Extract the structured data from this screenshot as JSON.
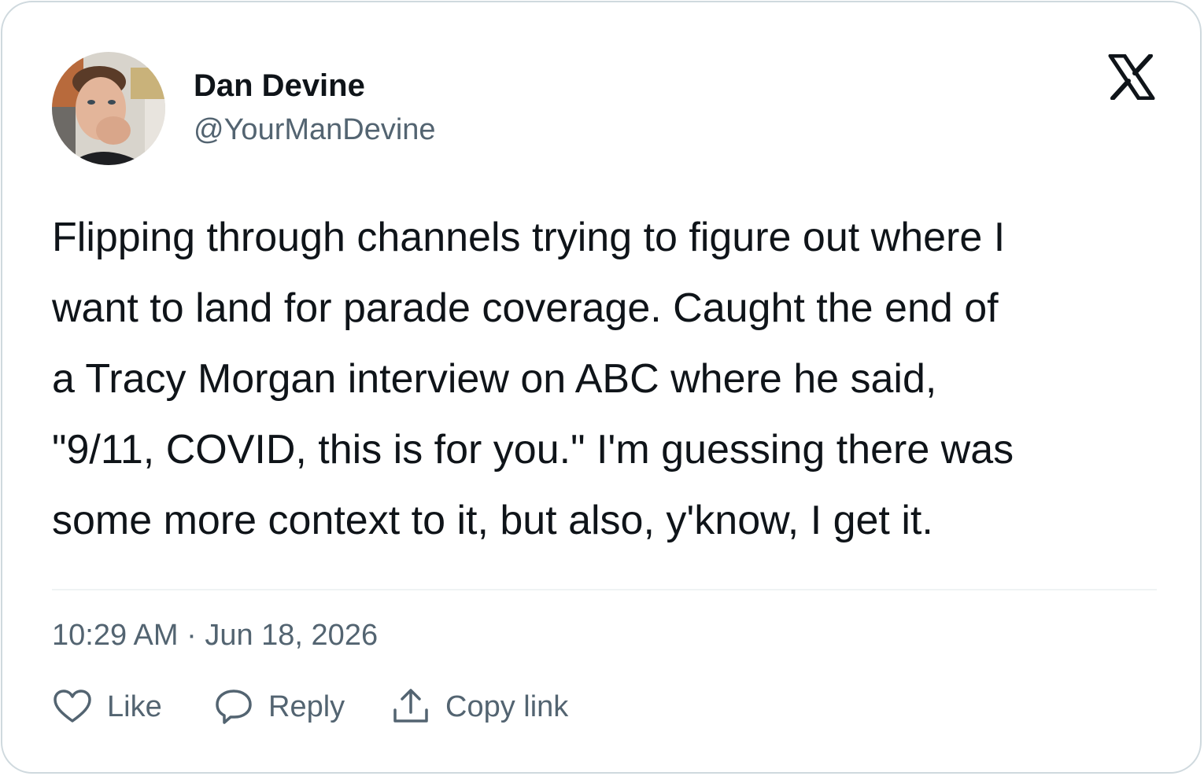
{
  "author": {
    "name": "Dan Devine",
    "handle": "@YourManDevine",
    "avatar_icon": "profile-photo"
  },
  "brand": {
    "logo": "x-logo",
    "color": "#0f1419"
  },
  "tweet": {
    "lines": [
      "Flipping through channels trying to figure out where I",
      "want to land for parade coverage. Caught the end of",
      "a Tracy Morgan interview on ABC where he said,",
      "\"9/11, COVID, this is for you.\" I'm guessing there was",
      "some more context to it, but also, y'know, I get it."
    ]
  },
  "meta": {
    "time": "10:29 AM",
    "separator": "·",
    "date": "Jun 18, 2026"
  },
  "actions": [
    {
      "label": "Like",
      "icon": "heart-icon"
    },
    {
      "label": "Reply",
      "icon": "speech-bubble-icon"
    },
    {
      "label": "Copy link",
      "icon": "upload-icon"
    }
  ],
  "colors": {
    "text": "#0f1419",
    "secondary": "#536471",
    "border": "#cfd9de",
    "divider": "#eff3f4"
  }
}
